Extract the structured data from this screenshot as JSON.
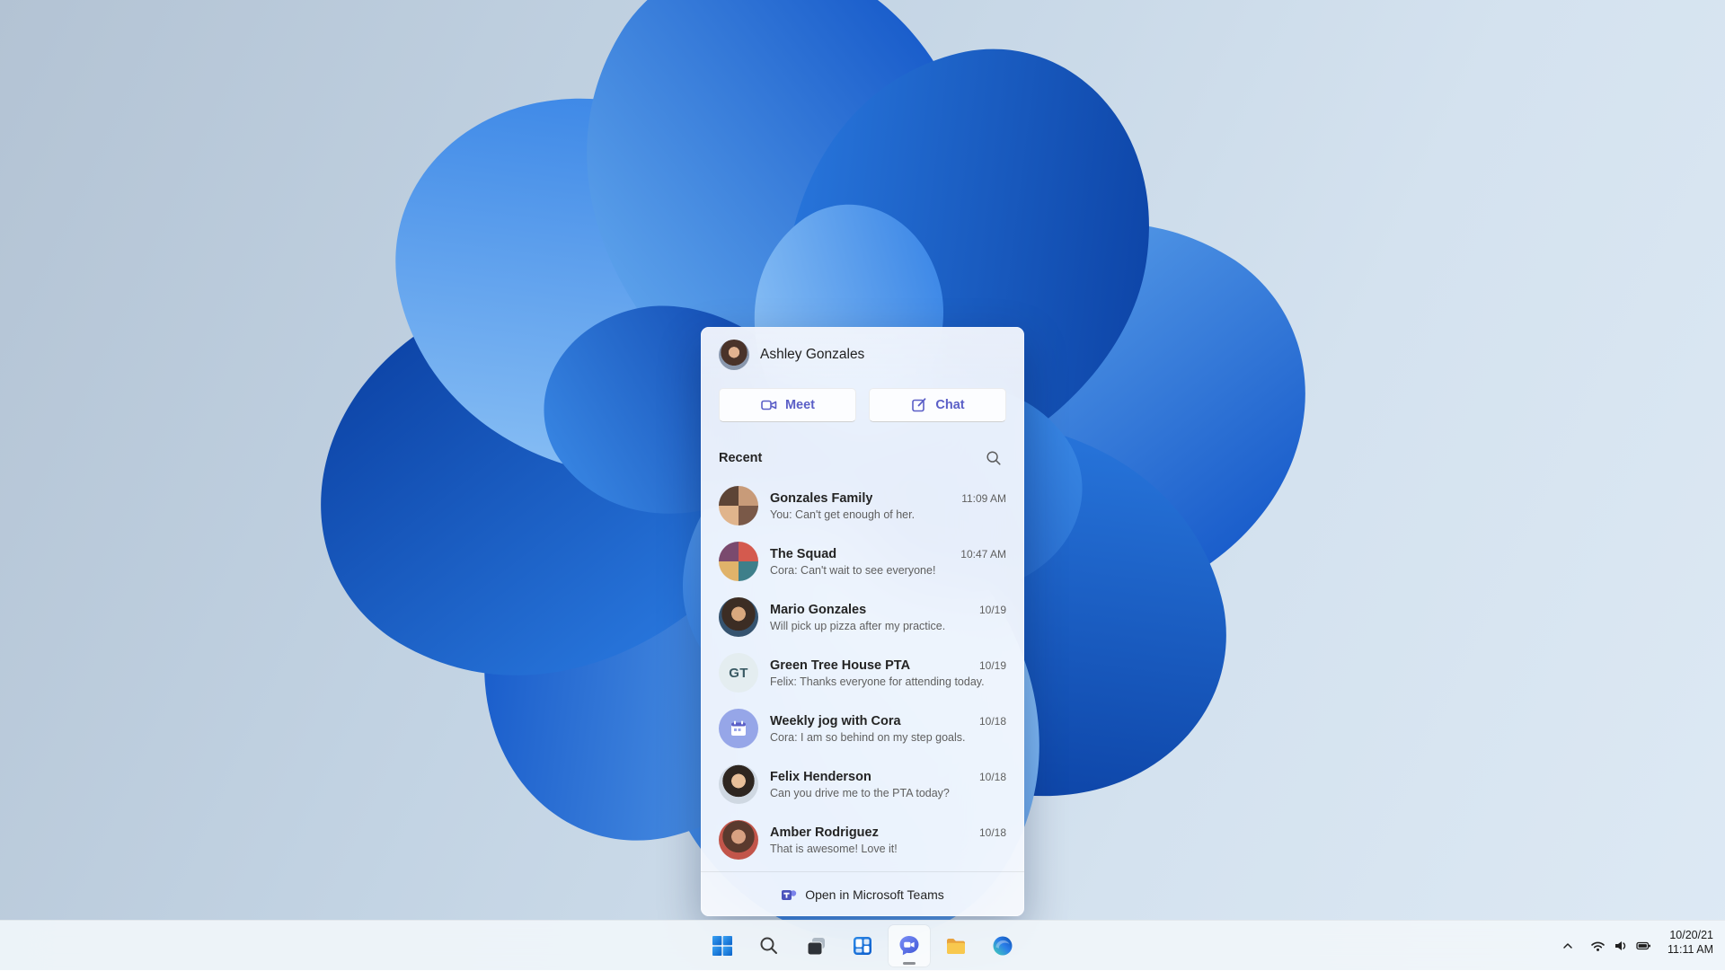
{
  "colors": {
    "teams_purple": "#5b5fc7",
    "accent_blue": "#0f6cbd",
    "taskbar_bg": "#f0f5fa",
    "panel_bg": "#f8fafd"
  },
  "flyout": {
    "header": {
      "user_name": "Ashley Gonzales"
    },
    "actions": {
      "meet_label": "Meet",
      "chat_label": "Chat"
    },
    "recent": {
      "label": "Recent",
      "search_icon": "magnifier"
    },
    "conversations": [
      {
        "name": "Gonzales Family",
        "preview": "You: Can't get enough of her.",
        "time": "11:09 AM",
        "avatar": {
          "type": "group-photo"
        }
      },
      {
        "name": "The Squad",
        "preview": "Cora: Can't wait to see everyone!",
        "time": "10:47 AM",
        "avatar": {
          "type": "group-photo"
        }
      },
      {
        "name": "Mario Gonzales",
        "preview": "Will pick up pizza after my practice.",
        "time": "10/19",
        "avatar": {
          "type": "photo"
        }
      },
      {
        "name": "Green Tree House PTA",
        "preview": "Felix: Thanks everyone for attending today.",
        "time": "10/19",
        "avatar": {
          "type": "initials",
          "initials": "GT"
        }
      },
      {
        "name": "Weekly jog with Cora",
        "preview": "Cora: I am so behind on my step goals.",
        "time": "10/18",
        "avatar": {
          "type": "calendar-icon"
        }
      },
      {
        "name": "Felix Henderson",
        "preview": "Can you drive me to the PTA today?",
        "time": "10/18",
        "avatar": {
          "type": "photo"
        }
      },
      {
        "name": "Amber Rodriguez",
        "preview": "That is awesome! Love it!",
        "time": "10/18",
        "avatar": {
          "type": "photo"
        }
      }
    ],
    "footer": {
      "label": "Open in Microsoft Teams",
      "icon": "teams-logo"
    }
  },
  "taskbar": {
    "buttons": [
      {
        "name": "start",
        "icon": "windows-logo"
      },
      {
        "name": "search",
        "icon": "magnifier"
      },
      {
        "name": "task-view",
        "icon": "stacked-windows"
      },
      {
        "name": "widgets",
        "icon": "widgets-board"
      },
      {
        "name": "chat",
        "icon": "chat-bubble",
        "active": true
      },
      {
        "name": "file-explorer",
        "icon": "folder"
      },
      {
        "name": "edge",
        "icon": "edge-swirl"
      }
    ],
    "tray": {
      "icons": [
        "chevron-up",
        "wifi",
        "volume",
        "battery"
      ],
      "date": "10/20/21",
      "time": "11:11 AM"
    }
  }
}
